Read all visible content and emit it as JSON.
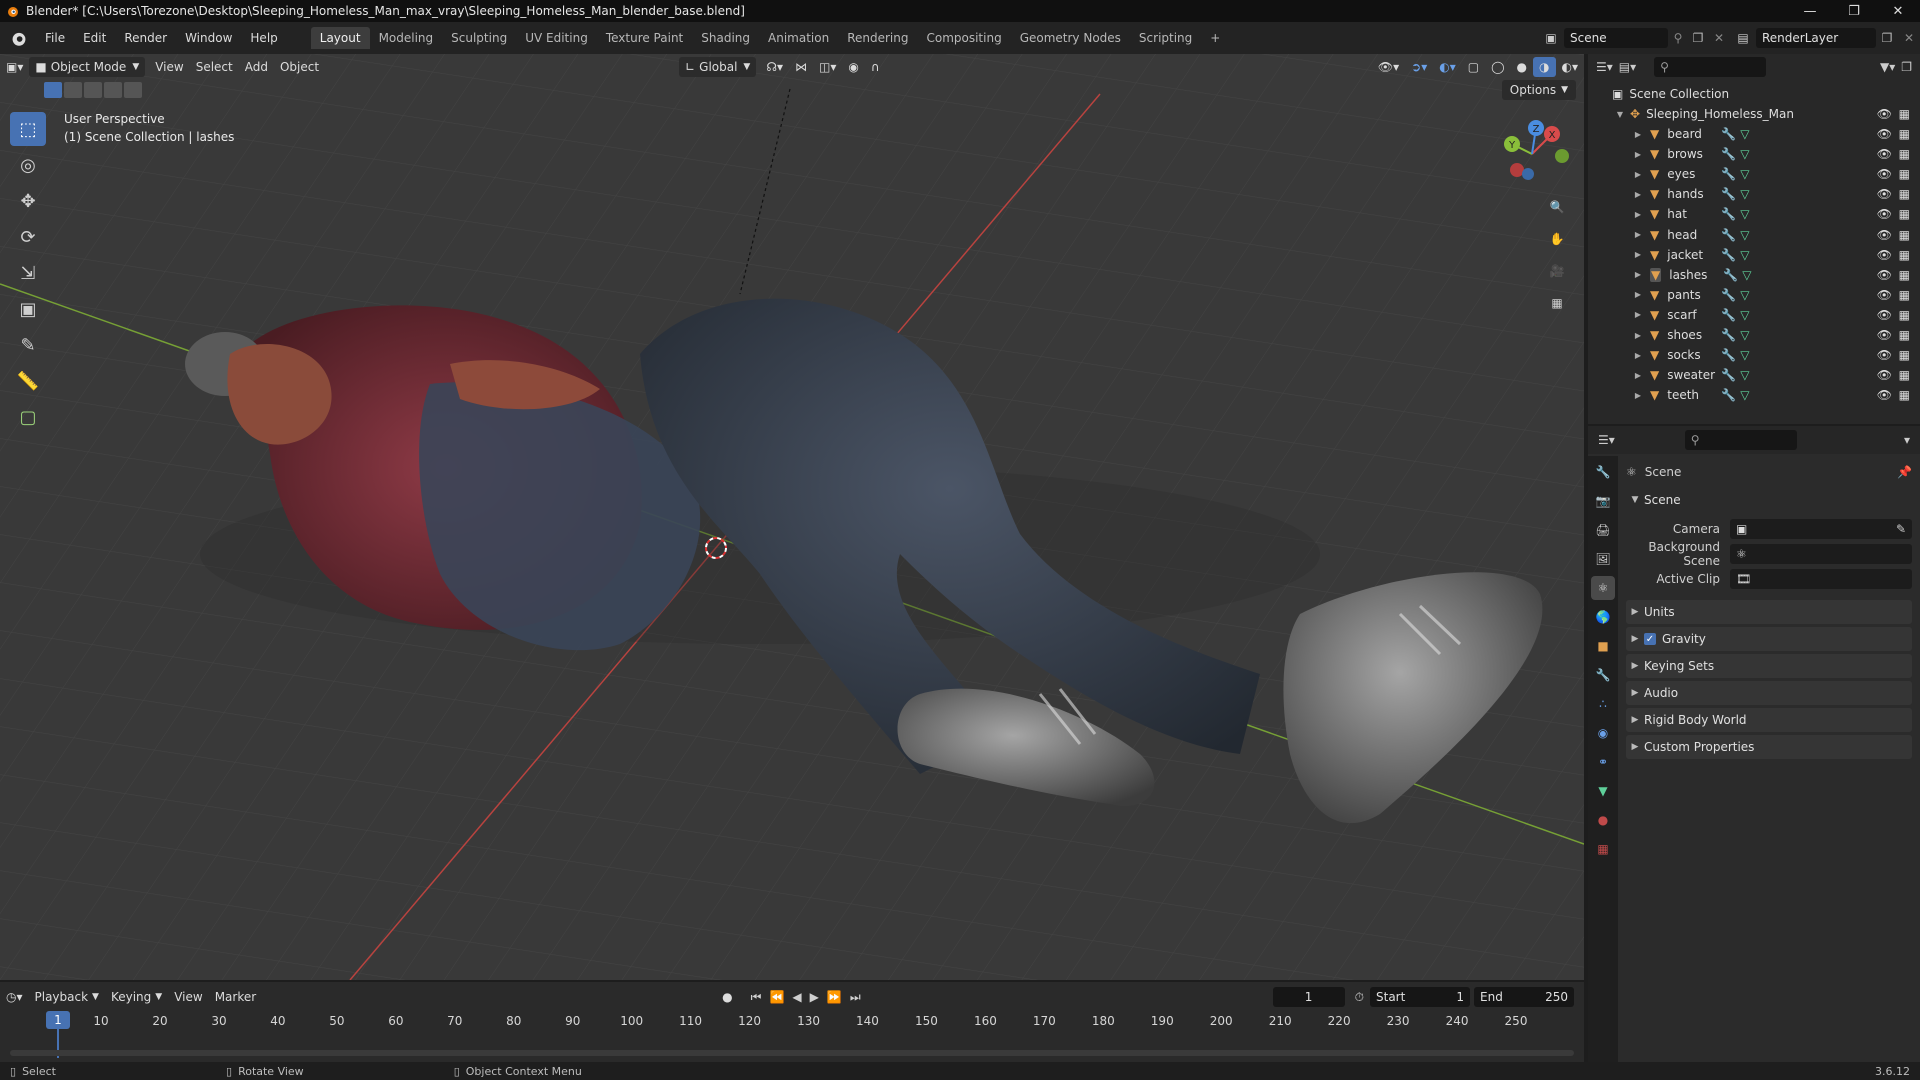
{
  "window": {
    "title": "Blender* [C:\\Users\\Torezone\\Desktop\\Sleeping_Homeless_Man_max_vray\\Sleeping_Homeless_Man_blender_base.blend]"
  },
  "menu": {
    "items": [
      "File",
      "Edit",
      "Render",
      "Window",
      "Help"
    ],
    "workspaces": [
      "Layout",
      "Modeling",
      "Sculpting",
      "UV Editing",
      "Texture Paint",
      "Shading",
      "Animation",
      "Rendering",
      "Compositing",
      "Geometry Nodes",
      "Scripting"
    ],
    "active_workspace": "Layout",
    "scene_name": "Scene",
    "view_layer": "RenderLayer"
  },
  "viewport": {
    "mode": "Object Mode",
    "menus": [
      "View",
      "Select",
      "Add",
      "Object"
    ],
    "transform_orientation": "Global",
    "options_label": "Options",
    "info_line1": "User Perspective",
    "info_line2": "(1) Scene Collection | lashes",
    "gizmo": {
      "x": "X",
      "y": "Y",
      "z": "Z"
    }
  },
  "outliner": {
    "root": "Scene Collection",
    "collection": "Sleeping_Homeless_Man",
    "objects": [
      "beard",
      "brows",
      "eyes",
      "hands",
      "hat",
      "head",
      "jacket",
      "lashes",
      "pants",
      "scarf",
      "shoes",
      "socks",
      "sweater",
      "teeth"
    ]
  },
  "properties": {
    "context": "Scene",
    "panel_title": "Scene",
    "fields": [
      {
        "label": "Camera"
      },
      {
        "label": "Background Scene"
      },
      {
        "label": "Active Clip"
      }
    ],
    "sections": [
      "Units",
      "Gravity",
      "Keying Sets",
      "Audio",
      "Rigid Body World",
      "Custom Properties"
    ],
    "gravity_enabled": true
  },
  "timeline": {
    "menus": [
      "Playback",
      "Keying",
      "View",
      "Marker"
    ],
    "current_frame": "1",
    "start_label": "Start",
    "start": "1",
    "end_label": "End",
    "end": "250",
    "ticks": [
      "1",
      "10",
      "20",
      "30",
      "40",
      "50",
      "60",
      "70",
      "80",
      "90",
      "100",
      "110",
      "120",
      "130",
      "140",
      "150",
      "160",
      "170",
      "180",
      "190",
      "200",
      "210",
      "220",
      "230",
      "240",
      "250"
    ]
  },
  "statusbar": {
    "items": [
      "Select",
      "Rotate View",
      "Object Context Menu"
    ],
    "version": "3.6.12"
  },
  "colors": {
    "accent": "#4772b3",
    "x_axis": "#c0392b",
    "y_axis": "#7fa72c",
    "mesh_icon": "#e0a050",
    "modifier_icon": "#6aa0e8",
    "data_icon": "#5fd09a"
  }
}
